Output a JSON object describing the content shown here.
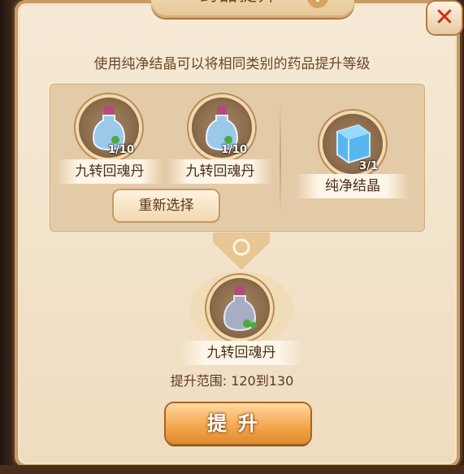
{
  "dialog": {
    "title": "药品提升",
    "description": "使用纯净结晶可以将相同类别的药品提升等级"
  },
  "materials": [
    {
      "name": "九转回魂丹",
      "quantity": "1/10",
      "icon": "potion-bottle-icon"
    },
    {
      "name": "九转回魂丹",
      "quantity": "1/10",
      "icon": "potion-bottle-icon"
    }
  ],
  "crystal": {
    "name": "纯净结晶",
    "quantity": "3/1",
    "icon": "crystal-cube-icon"
  },
  "buttons": {
    "reselect": "重新选择",
    "upgrade": "提升"
  },
  "result": {
    "name": "九转回魂丹",
    "icon": "potion-bottle-icon"
  },
  "range_text": "提升范围: 120到130",
  "colors": {
    "panel": "#f2e2c8",
    "accent": "#f4a850",
    "close": "#d62a1a"
  }
}
